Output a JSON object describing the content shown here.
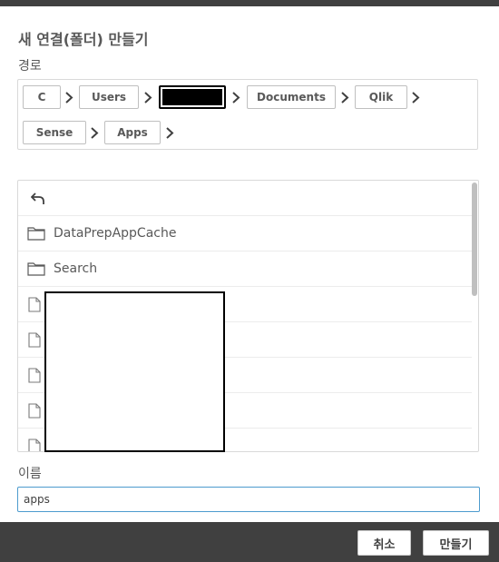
{
  "dialog": {
    "title": "새 연결(폴더) 만들기",
    "path_label": "경로",
    "name_label": "이름"
  },
  "breadcrumb": [
    {
      "label": "C"
    },
    {
      "label": "Users"
    },
    {
      "label": "",
      "redacted": true
    },
    {
      "label": "Documents"
    },
    {
      "label": "Qlik"
    },
    {
      "label": "Sense"
    },
    {
      "label": "Apps"
    }
  ],
  "file_list": {
    "back_icon": "back-arrow-icon",
    "folders": [
      {
        "name": "DataPrepAppCache",
        "icon": "folder-icon"
      },
      {
        "name": "Search",
        "icon": "folder-icon"
      }
    ],
    "files_redacted_count": 5
  },
  "name_input": {
    "value": "apps"
  },
  "footer": {
    "cancel_label": "취소",
    "create_label": "만들기"
  },
  "colors": {
    "footer_bg": "#404040",
    "input_focus_border": "#4d9bce"
  }
}
